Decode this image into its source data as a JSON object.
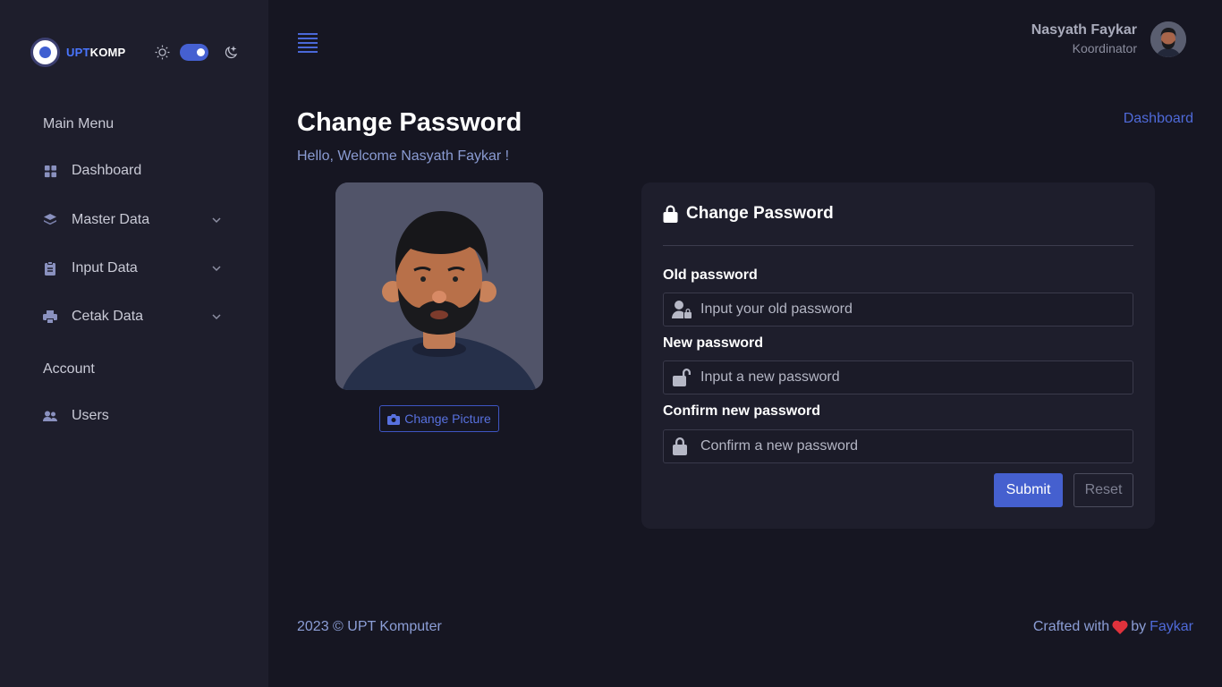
{
  "brand": {
    "part1": "UPT",
    "part2": "KOMP",
    "logo_icon": "upt-logo-icon"
  },
  "theme": {
    "light_icon": "sun-icon",
    "dark_icon": "moon-icon",
    "dark_mode": true
  },
  "sidebar": {
    "main_heading": "Main Menu",
    "account_heading": "Account",
    "items": [
      {
        "label": "Dashboard",
        "icon": "grid-icon"
      },
      {
        "label": "Master Data",
        "icon": "layers-icon",
        "expandable": true
      },
      {
        "label": "Input Data",
        "icon": "clipboard-icon",
        "expandable": true
      },
      {
        "label": "Cetak Data",
        "icon": "printer-icon",
        "expandable": true
      },
      {
        "label": "Users",
        "icon": "users-icon"
      }
    ]
  },
  "header": {
    "user_name": "Nasyath Faykar",
    "user_role": "Koordinator",
    "menu_icon": "hamburger-icon"
  },
  "page": {
    "title": "Change Password",
    "welcome": "Hello, Welcome Nasyath Faykar !",
    "breadcrumb": "Dashboard",
    "change_picture": "Change Picture"
  },
  "form": {
    "title": "Change Password",
    "old_label": "Old password",
    "old_placeholder": "Input your old password",
    "new_label": "New password",
    "new_placeholder": "Input a new password",
    "confirm_label": "Confirm new password",
    "confirm_placeholder": "Confirm a new password",
    "submit": "Submit",
    "reset": "Reset"
  },
  "footer": {
    "copyright": "2023 © UPT Komputer",
    "crafted_prefix": "Crafted with",
    "crafted_by": "by",
    "author": "Faykar"
  },
  "colors": {
    "accent": "#4560cf",
    "sidebar_bg": "#1e1e2c",
    "page_bg": "#161622",
    "heart": "#e0323c"
  }
}
